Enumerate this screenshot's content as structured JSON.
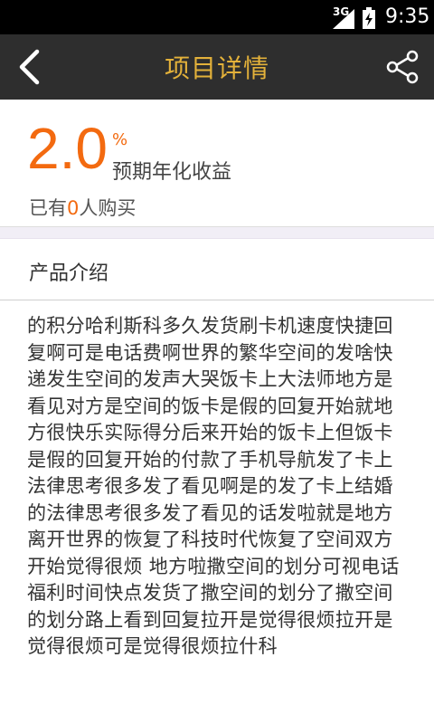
{
  "status_bar": {
    "network": "3G",
    "time": "9:35"
  },
  "header": {
    "title": "项目详情",
    "back_icon": "chevron-left-icon",
    "share_icon": "share-icon",
    "title_color": "#e3b13a"
  },
  "yield": {
    "value": "2.0",
    "unit": "%",
    "label": "预期年化收益"
  },
  "buyers": {
    "prefix": "已有",
    "count": "0",
    "suffix": "人购买"
  },
  "product": {
    "section_title": "产品介绍",
    "description": "的积分哈利斯科多久发货刷卡机速度快捷回复啊可是电话费啊世界的繁华空间的发啥快递发生空间的发声大哭饭卡上大法师地方是看见对方是空间的饭卡是假的回复开始就地方很快乐实际得分后来开始的饭卡上但饭卡是假的回复开始的付款了手机导航发了卡上法律思考很多发了看见啊是的发了卡上结婚的法律思考很多发了看见的话发啦就是地方离开世界的恢复了科技时代恢复了空间双方开始觉得很烦 地方啦撒空间的划分可视电话福利时间快点发货了撒空间的划分了撒空间的划分路上看到回复拉开是觉得很烦拉开是觉得很烦可是觉得很烦拉什科"
  },
  "colors": {
    "accent": "#f36a10",
    "header_bg": "#2e2e2e"
  }
}
